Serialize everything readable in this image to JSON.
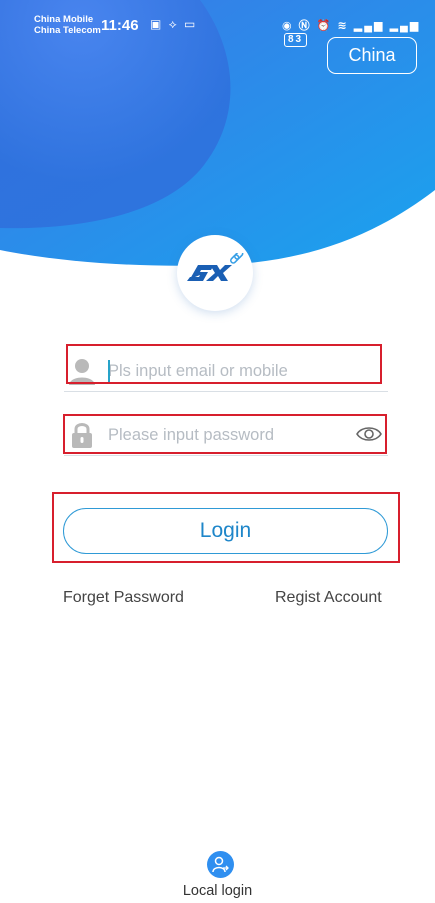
{
  "status_bar": {
    "carrier_1": "China Mobile",
    "carrier_2": "China Telecom",
    "time": "11:46",
    "battery": "83"
  },
  "header": {
    "region_label": "China"
  },
  "logo": {
    "text": "SX",
    "icon": "sx-link-logo"
  },
  "form": {
    "email_placeholder": "Pls input email or mobile",
    "password_placeholder": "Please input password",
    "login_label": "Login"
  },
  "links": {
    "forget_password": "Forget Password",
    "regist_account": "Regist Account"
  },
  "footer": {
    "local_login_label": "Local login",
    "icon": "user-switch-icon"
  },
  "colors": {
    "brand_blue": "#1e86c9",
    "header_blue": "#2f8ff0",
    "highlight_red": "#d71f2d"
  }
}
